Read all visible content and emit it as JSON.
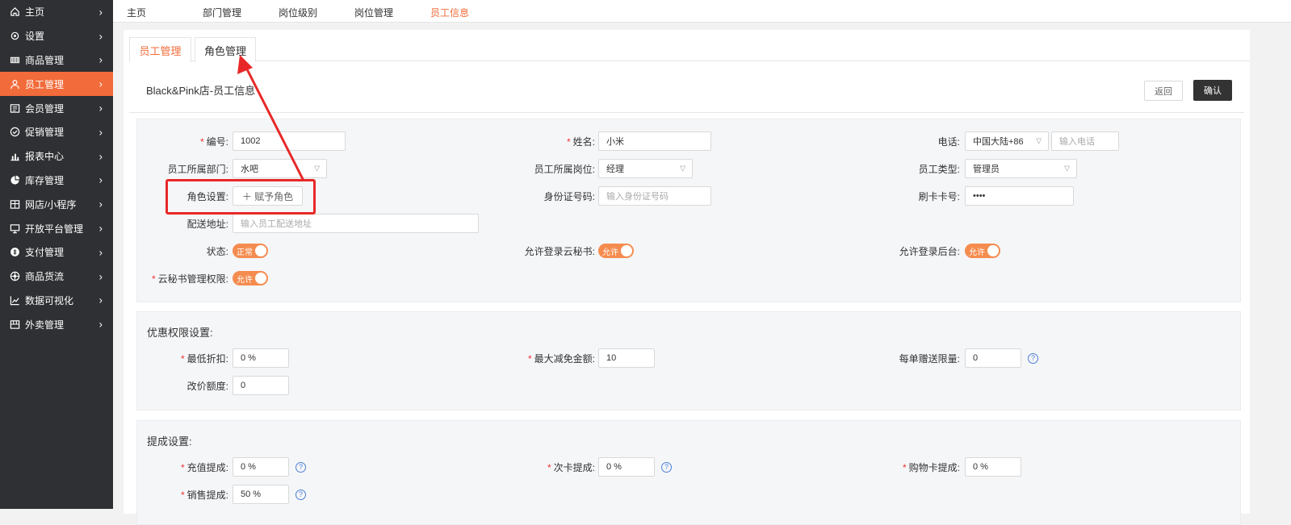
{
  "sidebar": {
    "items": [
      {
        "label": "主页",
        "icon": "home-icon"
      },
      {
        "label": "设置",
        "icon": "gear-icon"
      },
      {
        "label": "商品管理",
        "icon": "barcode-icon"
      },
      {
        "label": "员工管理",
        "icon": "user-icon",
        "active": true
      },
      {
        "label": "会员管理",
        "icon": "member-card-icon"
      },
      {
        "label": "促销管理",
        "icon": "check-circle-icon"
      },
      {
        "label": "报表中心",
        "icon": "bar-chart-icon"
      },
      {
        "label": "库存管理",
        "icon": "pie-chart-icon"
      },
      {
        "label": "网店/小程序",
        "icon": "store-icon"
      },
      {
        "label": "开放平台管理",
        "icon": "monitor-icon"
      },
      {
        "label": "支付管理",
        "icon": "payment-icon"
      },
      {
        "label": "商品货流",
        "icon": "network-icon"
      },
      {
        "label": "数据可视化",
        "icon": "line-chart-icon"
      },
      {
        "label": "外卖管理",
        "icon": "delivery-icon"
      }
    ]
  },
  "topnav": {
    "items": [
      "主页",
      "部门管理",
      "岗位级别",
      "岗位管理",
      "员工信息"
    ]
  },
  "tabs": {
    "employee": "员工管理",
    "role": "角色管理"
  },
  "header": {
    "title": "Black&Pink店-员工信息",
    "back": "返回",
    "confirm": "确认"
  },
  "form": {
    "number_label": "编号:",
    "number_value": "1002",
    "name_label": "姓名:",
    "name_value": "小米",
    "phone_label": "电话:",
    "phone_region": "中国大陆+86",
    "phone_placeholder": "输入电话",
    "dept_label": "员工所属部门:",
    "dept_value": "水吧",
    "post_label": "员工所属岗位:",
    "post_value": "经理",
    "type_label": "员工类型:",
    "type_value": "管理员",
    "role_label": "角色设置:",
    "role_button": "＋ 赋予角色",
    "id_label": "身份证号码:",
    "id_placeholder": "输入身份证号码",
    "card_label": "刷卡卡号:",
    "card_value": "••••",
    "addr_label": "配送地址:",
    "addr_placeholder": "输入员工配送地址",
    "status_label": "状态:",
    "status_value": "正常",
    "cloud_label": "允许登录云秘书:",
    "cloud_value": "允许",
    "backend_label": "允许登录后台:",
    "backend_value": "允许",
    "cloudadmin_label": "云秘书管理权限:",
    "cloudadmin_value": "允许"
  },
  "discount": {
    "title": "优惠权限设置:",
    "min_label": "最低折扣:",
    "min_value": "0 %",
    "max_label": "最大减免金额:",
    "max_value": "10",
    "gift_label": "每单赠送限量:",
    "gift_value": "0",
    "price_label": "改价额度:",
    "price_value": "0"
  },
  "commission": {
    "title": "提成设置:",
    "recharge_label": "充值提成:",
    "recharge_value": "0 %",
    "timescard_label": "次卡提成:",
    "timescard_value": "0 %",
    "shopcard_label": "购物卡提成:",
    "shopcard_value": "0 %",
    "sales_label": "销售提成:",
    "sales_value": "50 %"
  },
  "colors": {
    "accent": "#f26b3a",
    "sidebar_bg": "#2f3033",
    "annotation": "#e82828"
  }
}
